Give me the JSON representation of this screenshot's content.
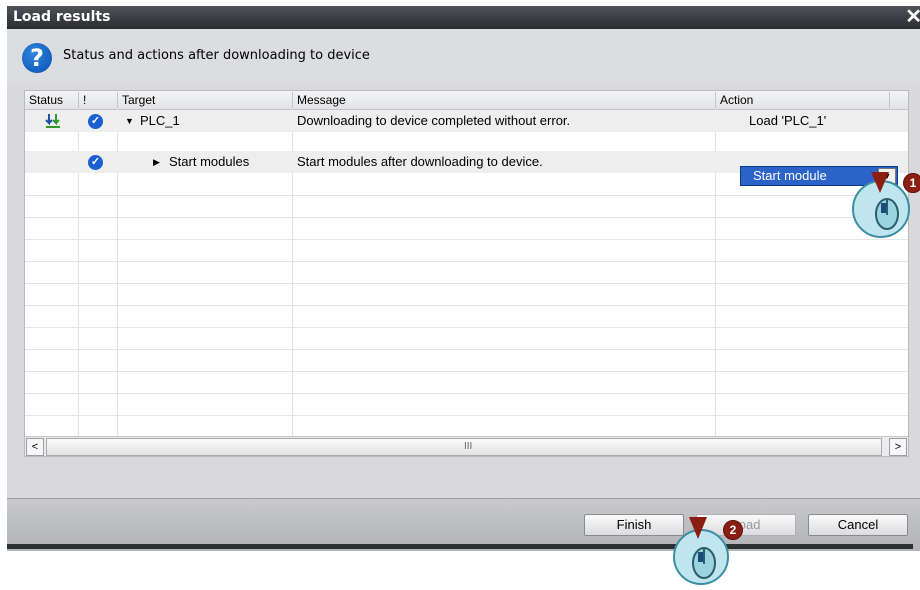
{
  "dialog": {
    "title": "Load results",
    "subtitle": "Status and actions after downloading to device"
  },
  "table": {
    "columns": [
      "Status",
      "!",
      "Target",
      "Message",
      "Action"
    ],
    "rows": [
      {
        "status_icon": "download-green-arrow-icon",
        "check": true,
        "expand": "▼",
        "target": "PLC_1",
        "message": "Downloading to device completed without error.",
        "action": "Load 'PLC_1'"
      },
      {
        "check": true,
        "expand": "▶",
        "target": "Start modules",
        "message": "Start modules after downloading to device.",
        "action": "Start module"
      }
    ]
  },
  "scrollbar": {
    "left": "<",
    "right": ">",
    "grip": "III"
  },
  "buttons": {
    "finish": "Finish",
    "load": "Load",
    "cancel": "Cancel"
  },
  "callouts": {
    "first": "1",
    "second": "2"
  },
  "colors": {
    "accent": "#2b63c9",
    "titlebar": "#2a2c30",
    "callout": "#8b1e12"
  }
}
